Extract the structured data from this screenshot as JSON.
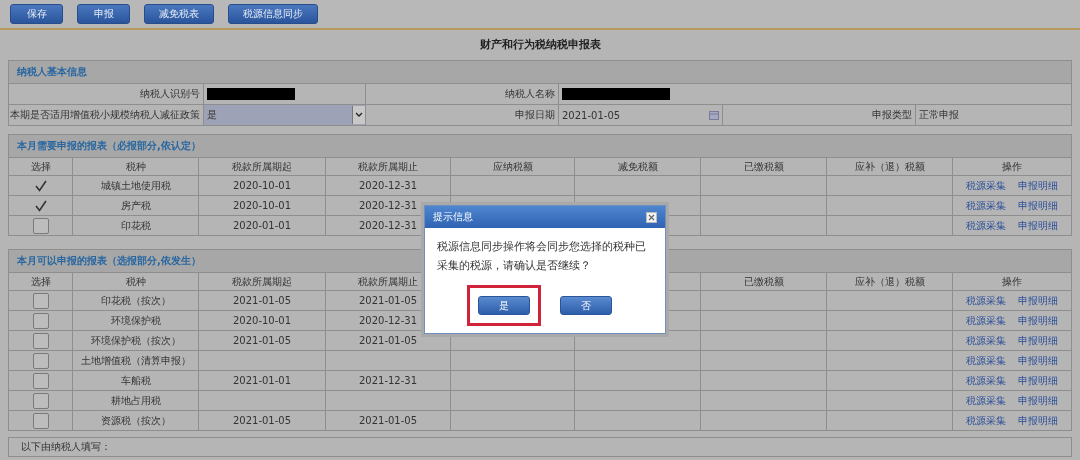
{
  "toolbar": {
    "buttons": [
      "保存",
      "申报",
      "减免税表",
      "税源信息同步"
    ]
  },
  "title": "财产和行为税纳税申报表",
  "basic_info": {
    "heading": "纳税人基本信息",
    "taxpayer_id": {
      "label": "纳税人识别号",
      "redacted": true
    },
    "taxpayer_name": {
      "label": "纳税人名称",
      "redacted": true
    },
    "policy": {
      "label": "本期是否适用增值税小规模纳税人减征政策",
      "value": "是"
    },
    "declaration_date": {
      "label": "申报日期",
      "value": "2021-01-05"
    },
    "declaration_type": {
      "label": "申报类型",
      "value": "正常申报"
    }
  },
  "required_table": {
    "heading": "本月需要申报的报表（必报部分,依认定）",
    "columns": [
      "选择",
      "税种",
      "税款所属期起",
      "税款所属期止",
      "应纳税额",
      "减免税额",
      "已缴税额",
      "应补（退）税额",
      "操作"
    ],
    "rows": [
      {
        "checked": true,
        "tax_type": "城镇土地使用税",
        "period_start": "2020-10-01",
        "period_end": "2020-12-31",
        "actions": [
          "税源采集",
          "申报明细"
        ]
      },
      {
        "checked": true,
        "tax_type": "房产税",
        "period_start": "2020-10-01",
        "period_end": "2020-12-31",
        "actions": [
          "税源采集",
          "申报明细"
        ]
      },
      {
        "checked": false,
        "tax_type": "印花税",
        "period_start": "2020-01-01",
        "period_end": "2020-12-31",
        "actions": [
          "税源采集",
          "申报明细"
        ]
      }
    ]
  },
  "optional_table": {
    "heading": "本月可以申报的报表（选报部分,依发生）",
    "columns": [
      "选择",
      "税种",
      "税款所属期起",
      "税款所属期止",
      null,
      null,
      "已缴税额",
      "应补（退）税额",
      "操作"
    ],
    "rows": [
      {
        "checked": false,
        "tax_type": "印花税（按次）",
        "period_start": "2021-01-05",
        "period_end": "2021-01-05",
        "actions": [
          "税源采集",
          "申报明细"
        ]
      },
      {
        "checked": false,
        "tax_type": "环境保护税",
        "period_start": "2020-10-01",
        "period_end": "2020-12-31",
        "actions": [
          "税源采集",
          "申报明细"
        ]
      },
      {
        "checked": false,
        "tax_type": "环境保护税（按次）",
        "period_start": "2021-01-05",
        "period_end": "2021-01-05",
        "actions": [
          "税源采集",
          "申报明细"
        ]
      },
      {
        "checked": false,
        "tax_type": "土地增值税（清算申报）",
        "actions": [
          "税源采集",
          "申报明细"
        ]
      },
      {
        "checked": false,
        "tax_type": "车船税",
        "period_start": "2021-01-01",
        "period_end": "2021-12-31",
        "actions": [
          "税源采集",
          "申报明细"
        ]
      },
      {
        "checked": false,
        "tax_type": "耕地占用税",
        "actions": [
          "税源采集",
          "申报明细"
        ]
      },
      {
        "checked": false,
        "tax_type": "资源税（按次）",
        "period_start": "2021-01-05",
        "period_end": "2021-01-05",
        "actions": [
          "税源采集",
          "申报明细"
        ]
      }
    ]
  },
  "footer_note": "以下由纳税人填写：",
  "dialog": {
    "title": "提示信息",
    "message": "税源信息同步操作将会同步您选择的税种已采集的税源，请确认是否继续？",
    "buttons": [
      {
        "label": "是",
        "highlighted": true
      },
      {
        "label": "否",
        "highlighted": false
      }
    ]
  }
}
